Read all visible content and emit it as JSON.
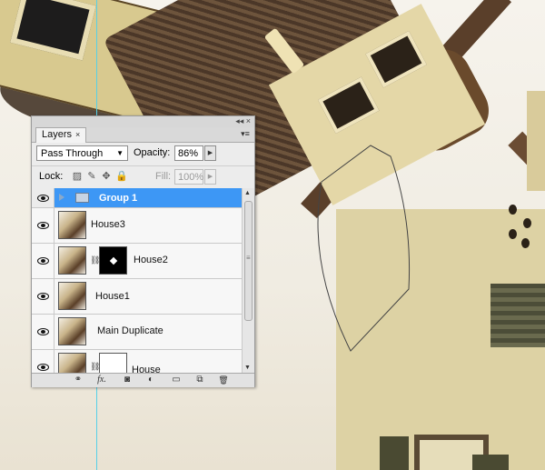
{
  "panel": {
    "tab_label": "Layers",
    "tab_close": "×",
    "titlebar_icons": "◂◂ ×",
    "menu_icon": "▾≡",
    "blend_mode": "Pass Through",
    "opacity_label": "Opacity:",
    "opacity_value": "86%",
    "lock_label": "Lock:",
    "fill_label": "Fill:",
    "fill_value": "100%"
  },
  "layers": [
    {
      "name": "Group 1",
      "type": "group",
      "visible": true,
      "selected": true
    },
    {
      "name": "House3",
      "type": "layer",
      "visible": true
    },
    {
      "name": "House2",
      "type": "layer_with_mask",
      "visible": true
    },
    {
      "name": "House1",
      "type": "layer",
      "visible": true
    },
    {
      "name": "Main Duplicate",
      "type": "layer",
      "visible": true
    },
    {
      "name": "House",
      "type": "layer_with_mask",
      "visible": true
    }
  ],
  "bottom_icons": [
    "link-layers-icon",
    "fx-icon",
    "add-mask-icon",
    "adjustment-layer-icon",
    "new-group-icon",
    "new-layer-icon",
    "trash-icon"
  ],
  "bottom_glyphs": {
    "link": "⚭",
    "fx": "fx.",
    "mask": "◙",
    "adjust": "◐",
    "group": "▭",
    "new": "⧉",
    "trash": "🗑"
  },
  "colors": {
    "selected_row": "#3d97f5",
    "guide": "#56d0e8"
  }
}
